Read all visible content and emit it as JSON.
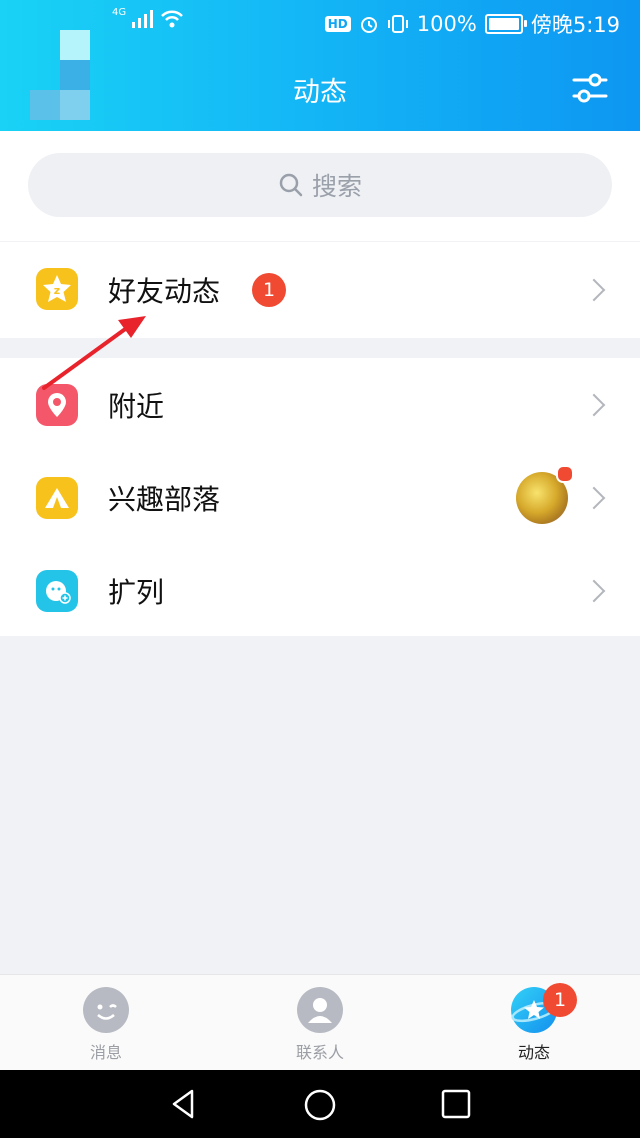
{
  "status_bar": {
    "network": "4G",
    "battery_percent": "100%",
    "battery_level": 1.0,
    "time": "傍晚5:19",
    "hd_label": "HD"
  },
  "header": {
    "title": "动态",
    "filter_icon": "filter-sliders-icon"
  },
  "search": {
    "placeholder": "搜索"
  },
  "friends_feed": {
    "label": "好友动态",
    "badge": "1",
    "icon": "qzone-star-icon",
    "icon_color": "#f8c21c"
  },
  "services": [
    {
      "label": "附近",
      "icon": "location-pin-icon",
      "icon_color": "#f4576a"
    },
    {
      "label": "兴趣部落",
      "icon": "tent-icon",
      "icon_color": "#f8c21c"
    },
    {
      "label": "扩列",
      "icon": "add-friend-face-icon",
      "icon_color": "#23c4e8"
    }
  ],
  "bottom_nav": {
    "items": [
      {
        "label": "消息",
        "icon": "message-face-icon"
      },
      {
        "label": "联系人",
        "icon": "contacts-person-icon"
      },
      {
        "label": "动态",
        "icon": "planet-star-icon",
        "badge": "1",
        "active": true
      }
    ]
  },
  "colors": {
    "header_start": "#19d2f5",
    "header_end": "#0d96f2",
    "badge_red": "#f04a32",
    "annotation_arrow": "#e8232b"
  }
}
